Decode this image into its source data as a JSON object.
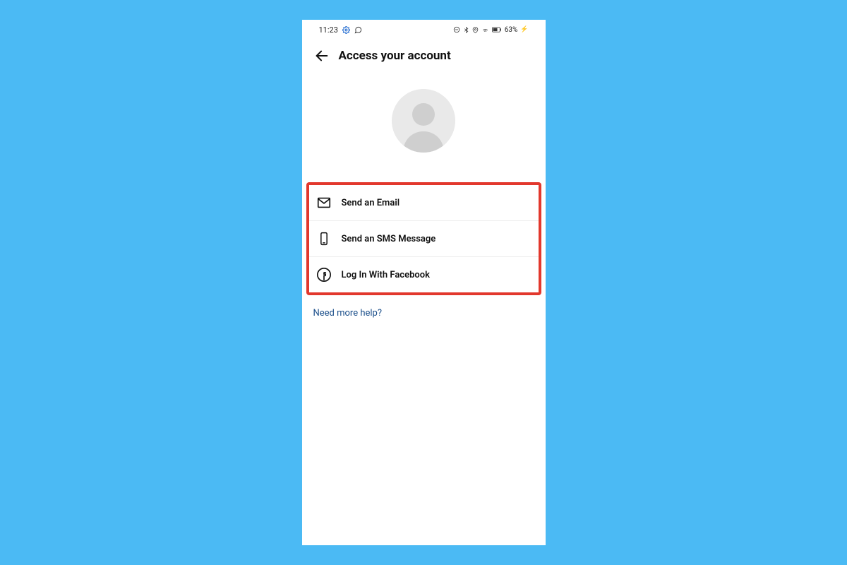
{
  "status_bar": {
    "time": "11:23",
    "battery": "63%",
    "charging_indicator": "⚡"
  },
  "header": {
    "title": "Access your account"
  },
  "options": [
    {
      "icon": "envelope",
      "label": "Send an Email"
    },
    {
      "icon": "phone",
      "label": "Send an SMS Message"
    },
    {
      "icon": "facebook",
      "label": "Log In With Facebook"
    }
  ],
  "help_link": "Need more help?",
  "colors": {
    "background": "#4bbaf4",
    "highlight": "#e2382d",
    "link": "#1a4e8a"
  }
}
